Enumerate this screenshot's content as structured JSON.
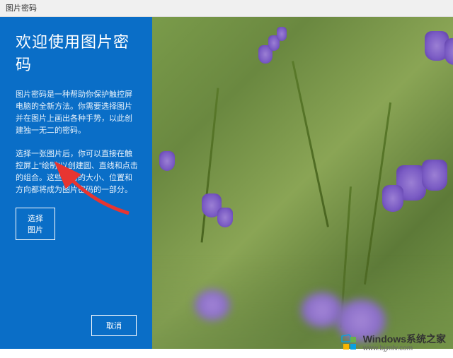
{
  "titlebar": {
    "title": "图片密码"
  },
  "panel": {
    "heading": "欢迎使用图片密码",
    "paragraph1": "图片密码是一种帮助你保护触控屏电脑的全新方法。你需要选择图片并在图片上画出各种手势，以此创建独一无二的密码。",
    "paragraph2": "选择一张图片后，你可以直接在触控屏上\"绘制\"以创建圆、直线和点击的组合。这些手势的大小、位置和方向都将成为图片密码的一部分。",
    "selectButton": "选择图片",
    "cancelButton": "取消"
  },
  "watermark": {
    "brand": "Windows",
    "suffix": "系统之家",
    "url": "www.bjjmlv.com"
  }
}
